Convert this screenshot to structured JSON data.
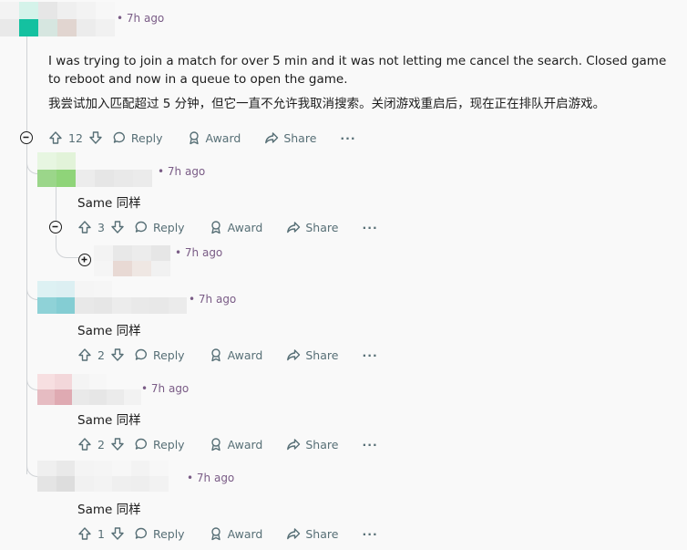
{
  "root": {
    "time": "7h ago",
    "body_en": "I was trying to join a match for over 5 min and it was not letting me cancel the search. Closed game to reboot and now in a queue to open the game.",
    "body_zh": "我尝试加入匹配超过 5 分钟，但它一直不允许我取消搜索。关闭游戏重启后，现在正在排队开启游戏。",
    "votes": "12"
  },
  "actions": {
    "reply": "Reply",
    "award": "Award",
    "share": "Share",
    "more": "···"
  },
  "replies": [
    {
      "time": "7h ago",
      "text": "Same   同样",
      "votes": "3"
    },
    {
      "time": "7h ago"
    },
    {
      "time": "7h ago",
      "text": "Same   同样",
      "votes": "2"
    },
    {
      "time": "7h ago",
      "text": "Same   同样",
      "votes": "2"
    },
    {
      "time": "7h ago",
      "text": "Same   同样",
      "votes": "1"
    }
  ],
  "colors": {
    "accent_time": "#7a5c86",
    "thread": "#d0d3d6",
    "action_text": "#576f76"
  },
  "icons": [
    "upvote-icon",
    "downvote-icon",
    "reply-bubble-icon",
    "award-icon",
    "share-arrow-icon",
    "collapse-minus-icon",
    "expand-plus-icon"
  ]
}
